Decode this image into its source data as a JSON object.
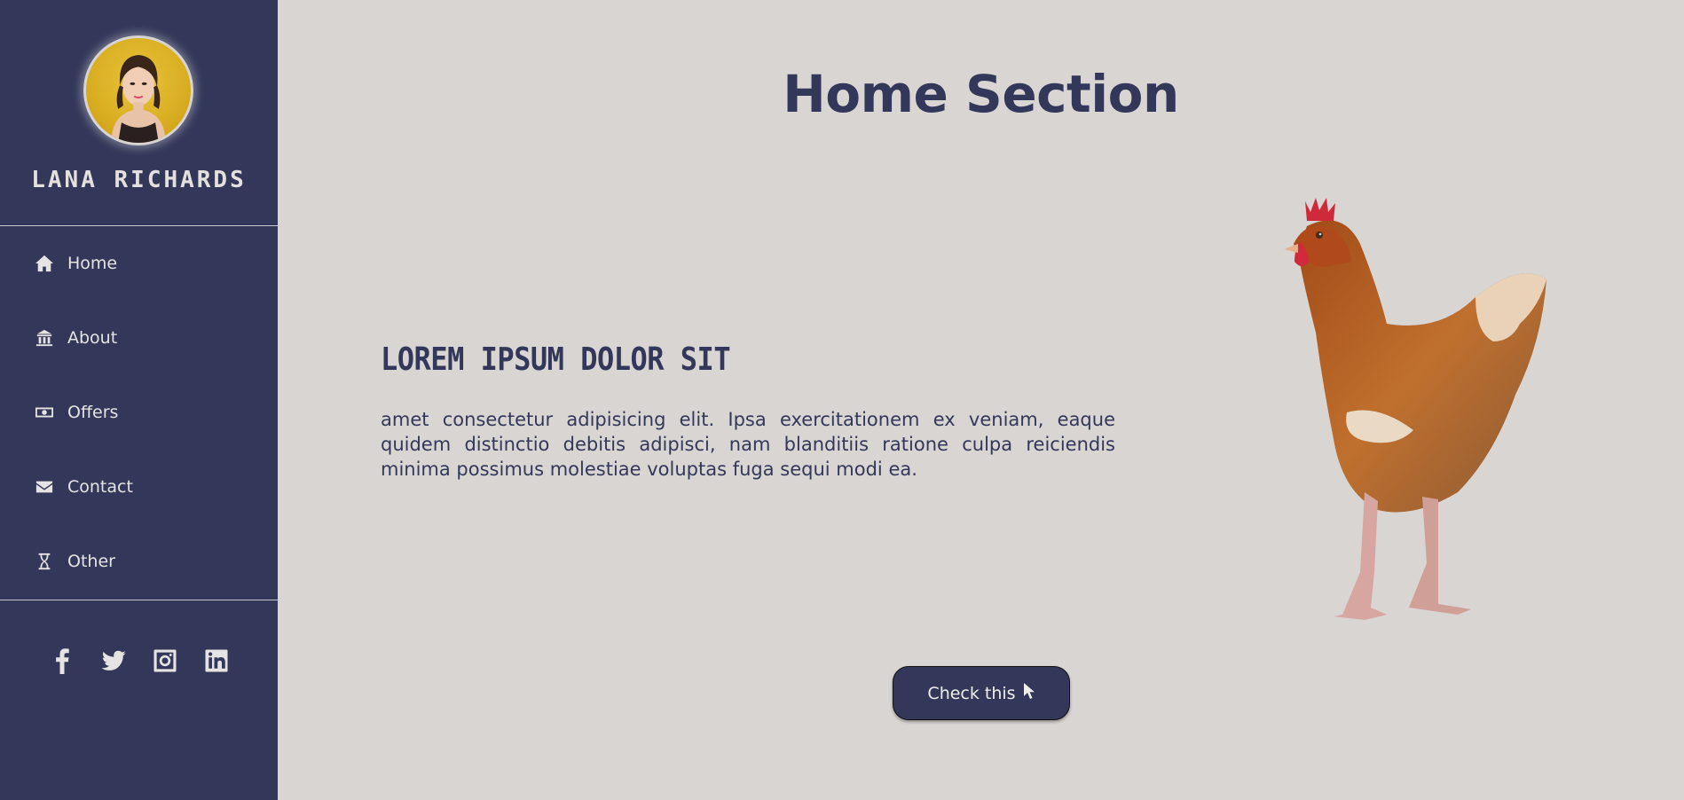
{
  "profile": {
    "name": "LANA RICHARDS"
  },
  "nav": {
    "items": [
      {
        "label": "Home",
        "icon": "home-icon"
      },
      {
        "label": "About",
        "icon": "building-icon"
      },
      {
        "label": "Offers",
        "icon": "money-icon"
      },
      {
        "label": "Contact",
        "icon": "envelope-icon"
      },
      {
        "label": "Other",
        "icon": "hourglass-icon"
      }
    ]
  },
  "social": [
    "facebook-icon",
    "twitter-icon",
    "instagram-icon",
    "linkedin-icon"
  ],
  "main": {
    "title": "Home Section",
    "subtitle": "LOREM IPSUM DOLOR SIT",
    "paragraph": "amet consectetur adipisicing elit. Ipsa exercitationem ex veniam, eaque quidem distinctio debitis adipisci, nam blanditiis ratione culpa reiciendis minima possimus molestiae voluptas fuga sequi modi ea.",
    "button_label": "Check this"
  },
  "colors": {
    "sidebar": "#33385a",
    "background": "#d8d5d3",
    "accent": "#33385a",
    "text_light": "#e6e4e2"
  }
}
